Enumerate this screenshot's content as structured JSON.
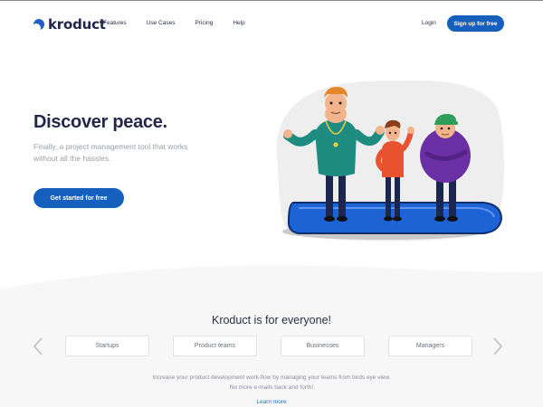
{
  "brand": {
    "name": "kroduct",
    "color": "#1560bd"
  },
  "nav": {
    "links": [
      "Features",
      "Use Cases",
      "Pricing",
      "Help"
    ],
    "login_label": "Login",
    "signup_label": "Sign up for free"
  },
  "hero": {
    "title": "Discover peace.",
    "subtitle": "Finally, a project management tool that works without all the hassles.",
    "cta_label": "Get started for free",
    "illustration": "three-cartoon-men-on-blue-skateboard"
  },
  "audience": {
    "title": "Kroduct is for everyone!",
    "categories": [
      "Startups",
      "Product teams",
      "Businesses",
      "Managers"
    ],
    "description_line1": "Increase your product development work-flow by managing your teams from birds eye view.",
    "description_line2": "No more e-mails back and forth!",
    "learn_more_label": "Learn more",
    "prev_icon": "chevron-left-icon",
    "next_icon": "chevron-right-icon"
  }
}
